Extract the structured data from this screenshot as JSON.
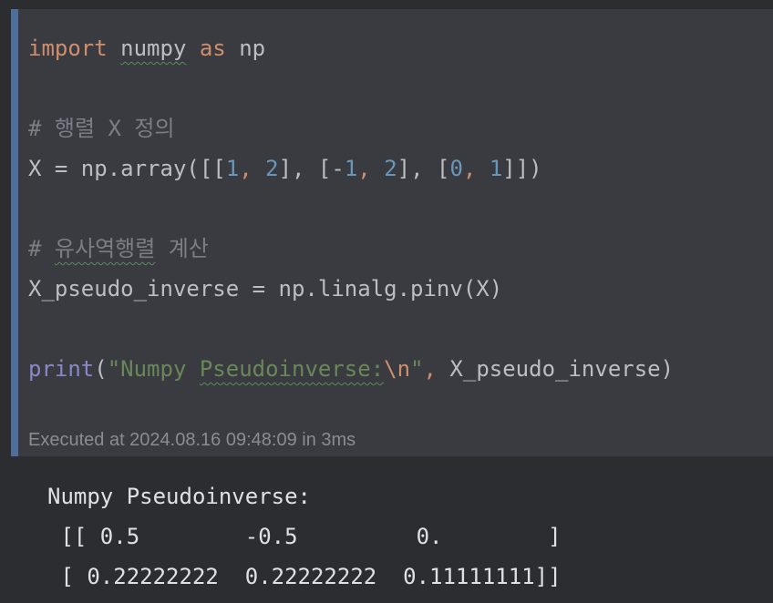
{
  "code": {
    "line1": {
      "kw_import": "import",
      "module": "numpy",
      "kw_as": "as",
      "alias": "np"
    },
    "line2": {
      "hash": "# ",
      "comment": "행렬 X 정의"
    },
    "line3": {
      "lhs": "X = np.array([[",
      "n1": "1",
      "c1": ", ",
      "n2": "2",
      "p1": "], ",
      "b1": "[-",
      "n3": "1",
      "c2": ", ",
      "n4": "2",
      "p2": "], ",
      "b2": "[",
      "n5": "0",
      "c3": ", ",
      "n6": "1",
      "end": "]])"
    },
    "line4": {
      "hash": "# ",
      "squiggled": "유사역행렬",
      "rest": " 계산"
    },
    "line5": {
      "text": "X_pseudo_inverse = np.linalg.pinv(X)"
    },
    "line6": {
      "fn": "print",
      "open": "(",
      "q1": "\"Numpy ",
      "squiggled": "Pseudoinverse:",
      "esc": "\\n",
      "q2": "\"",
      "comma": ", ",
      "arg": "X_pseudo_inverse",
      "close": ")"
    }
  },
  "execution_info": "Executed at 2024.08.16 09:48:09 in 3ms",
  "output": {
    "label": "Numpy Pseudoinverse:",
    "row1": " [[ 0.5        -0.5         0.        ]",
    "row2": " [ 0.22222222  0.22222222  0.11111111]]"
  },
  "colors": {
    "cell_background": "#393b40",
    "cell_accent_bar": "#4f6e9c",
    "keyword": "#cf8e6d",
    "number": "#6897bb",
    "string": "#6a8759",
    "comment": "#7a7e85",
    "builtin": "#8888c6"
  }
}
